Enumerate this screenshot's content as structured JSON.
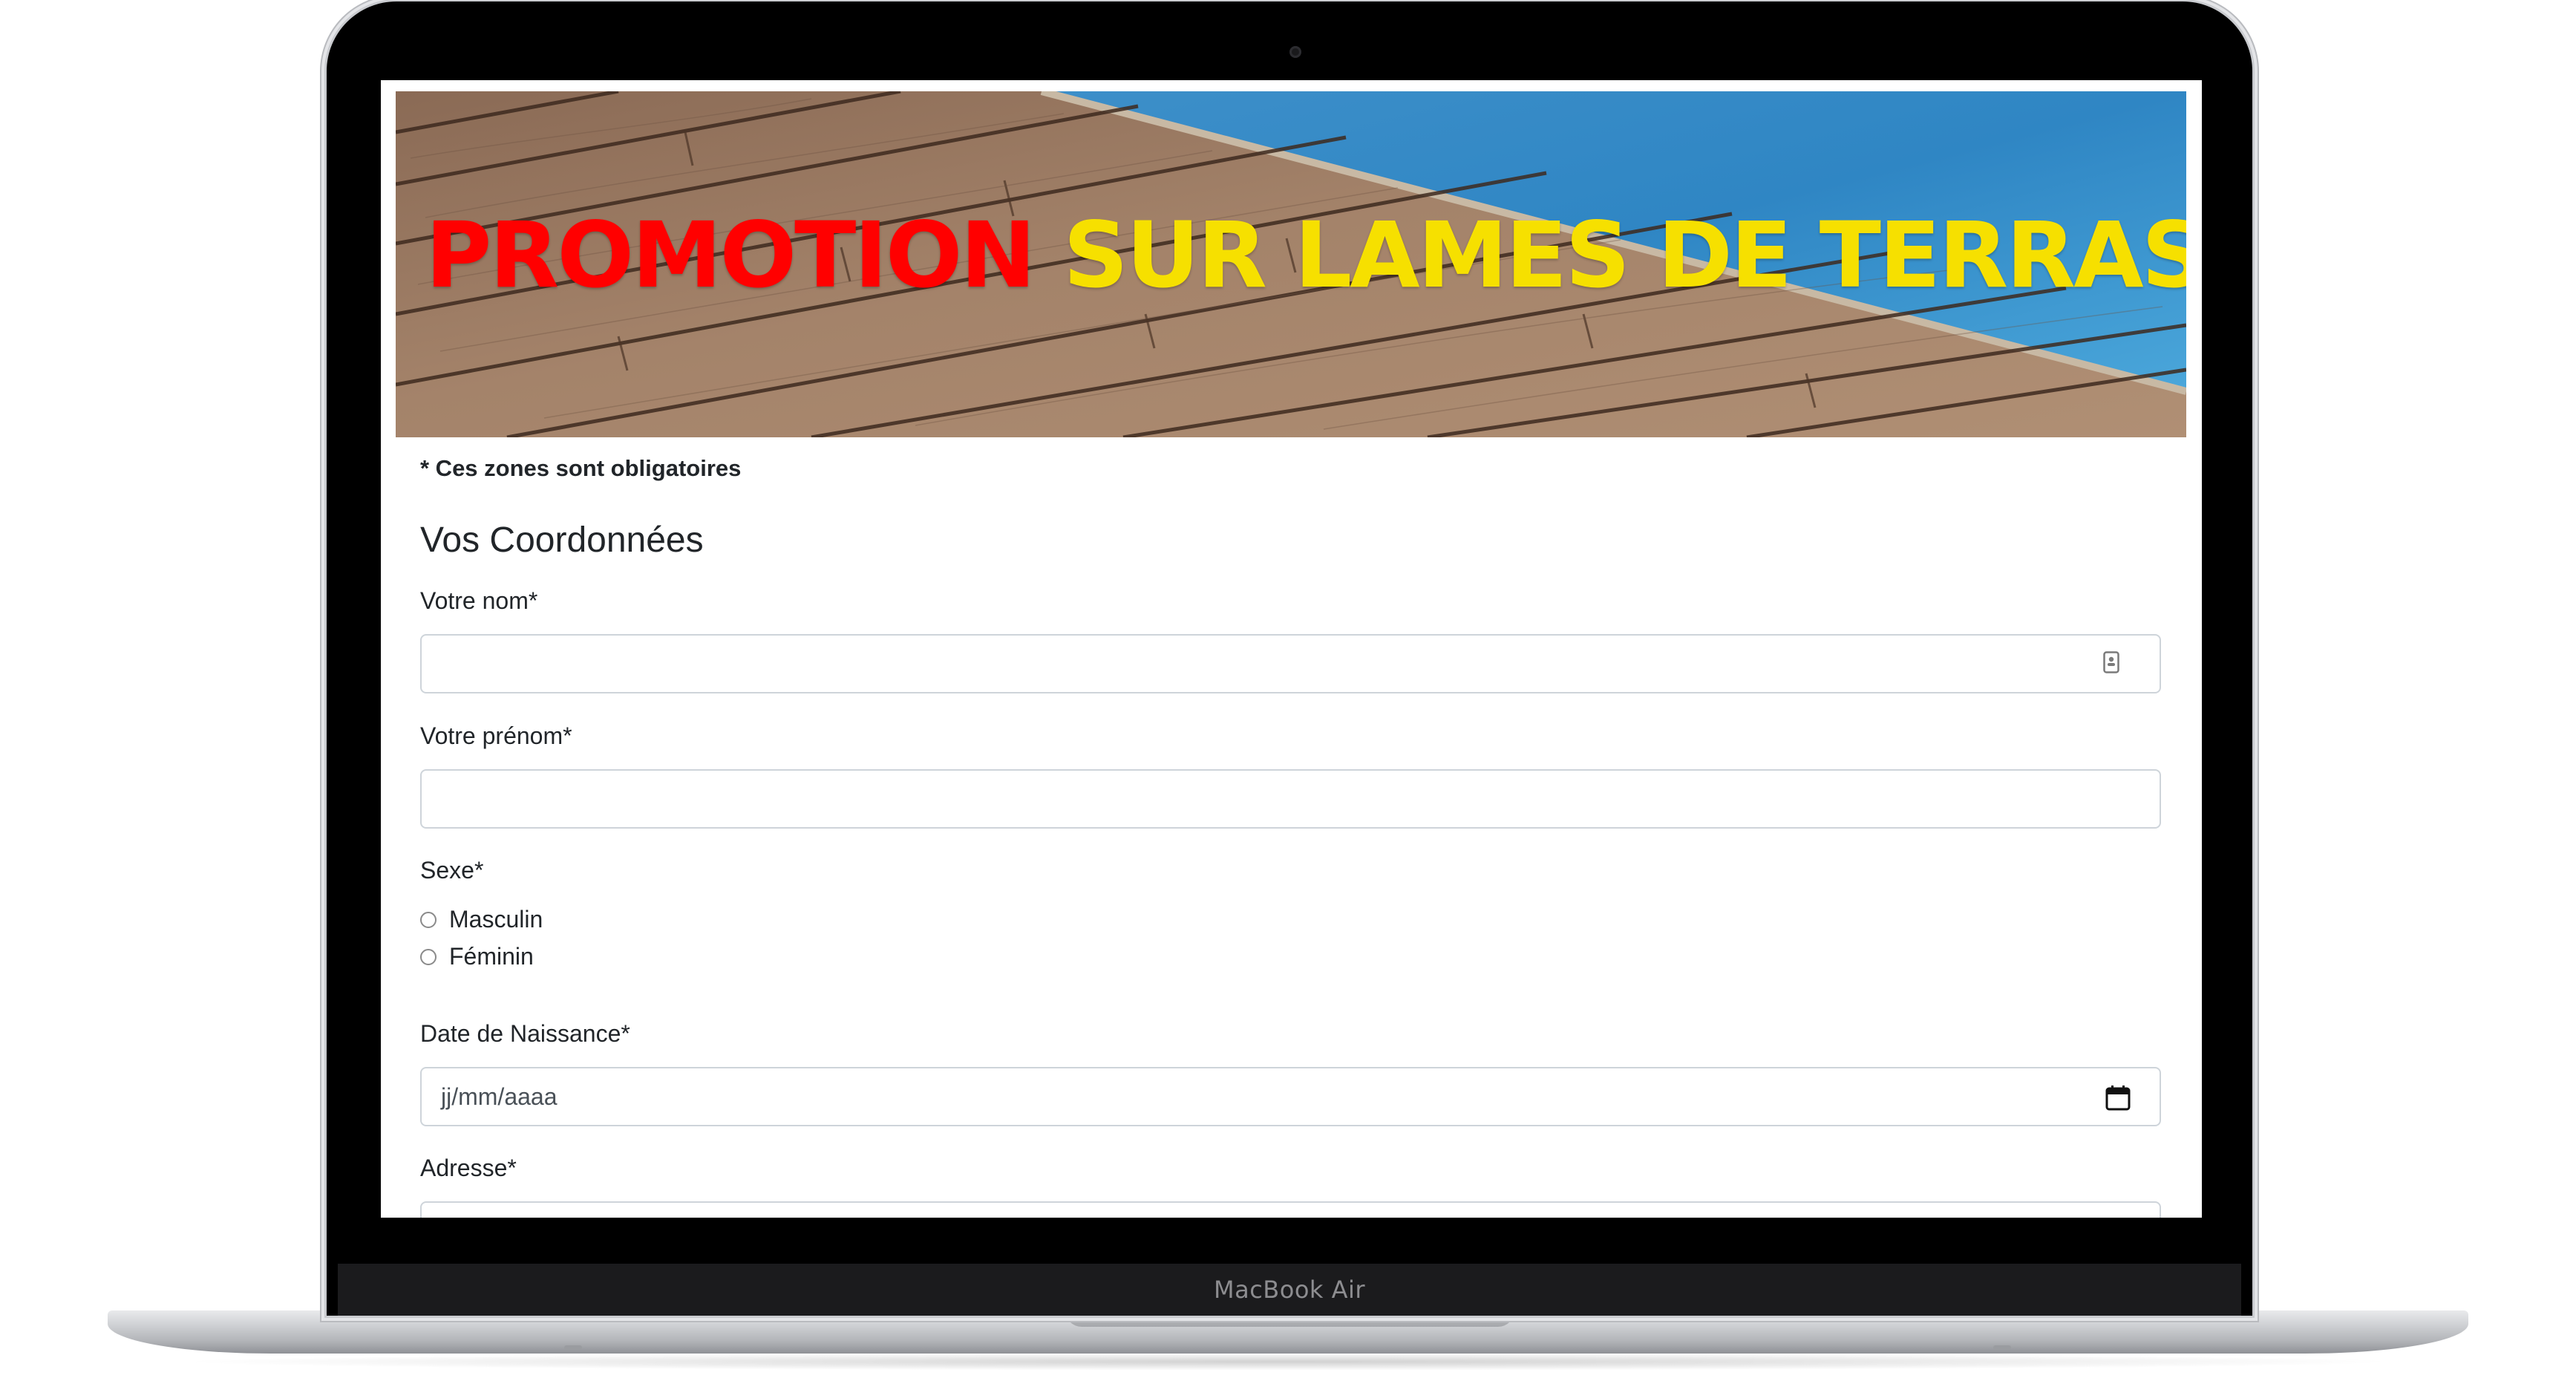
{
  "banner": {
    "title_red": "PROMOTION",
    "title_yellow": "SUR LAMES DE TERRASSE",
    "color_red": "#ff0000",
    "color_yellow": "#f6e000"
  },
  "form": {
    "required_note": "* Ces zones sont obligatoires",
    "section_title": "Vos Coordonnées",
    "nom": {
      "label": "Votre nom*",
      "value": ""
    },
    "prenom": {
      "label": "Votre prénom*",
      "value": ""
    },
    "sexe": {
      "label": "Sexe*",
      "options": [
        "Masculin",
        "Féminin"
      ]
    },
    "naissance": {
      "label": "Date de Naissance*",
      "placeholder": "jj/mm/aaaa"
    },
    "adresse": {
      "label": "Adresse*"
    }
  },
  "device": {
    "brand": "MacBook Air"
  },
  "icons": {
    "contact": "contact-card-icon",
    "calendar": "calendar-icon"
  }
}
